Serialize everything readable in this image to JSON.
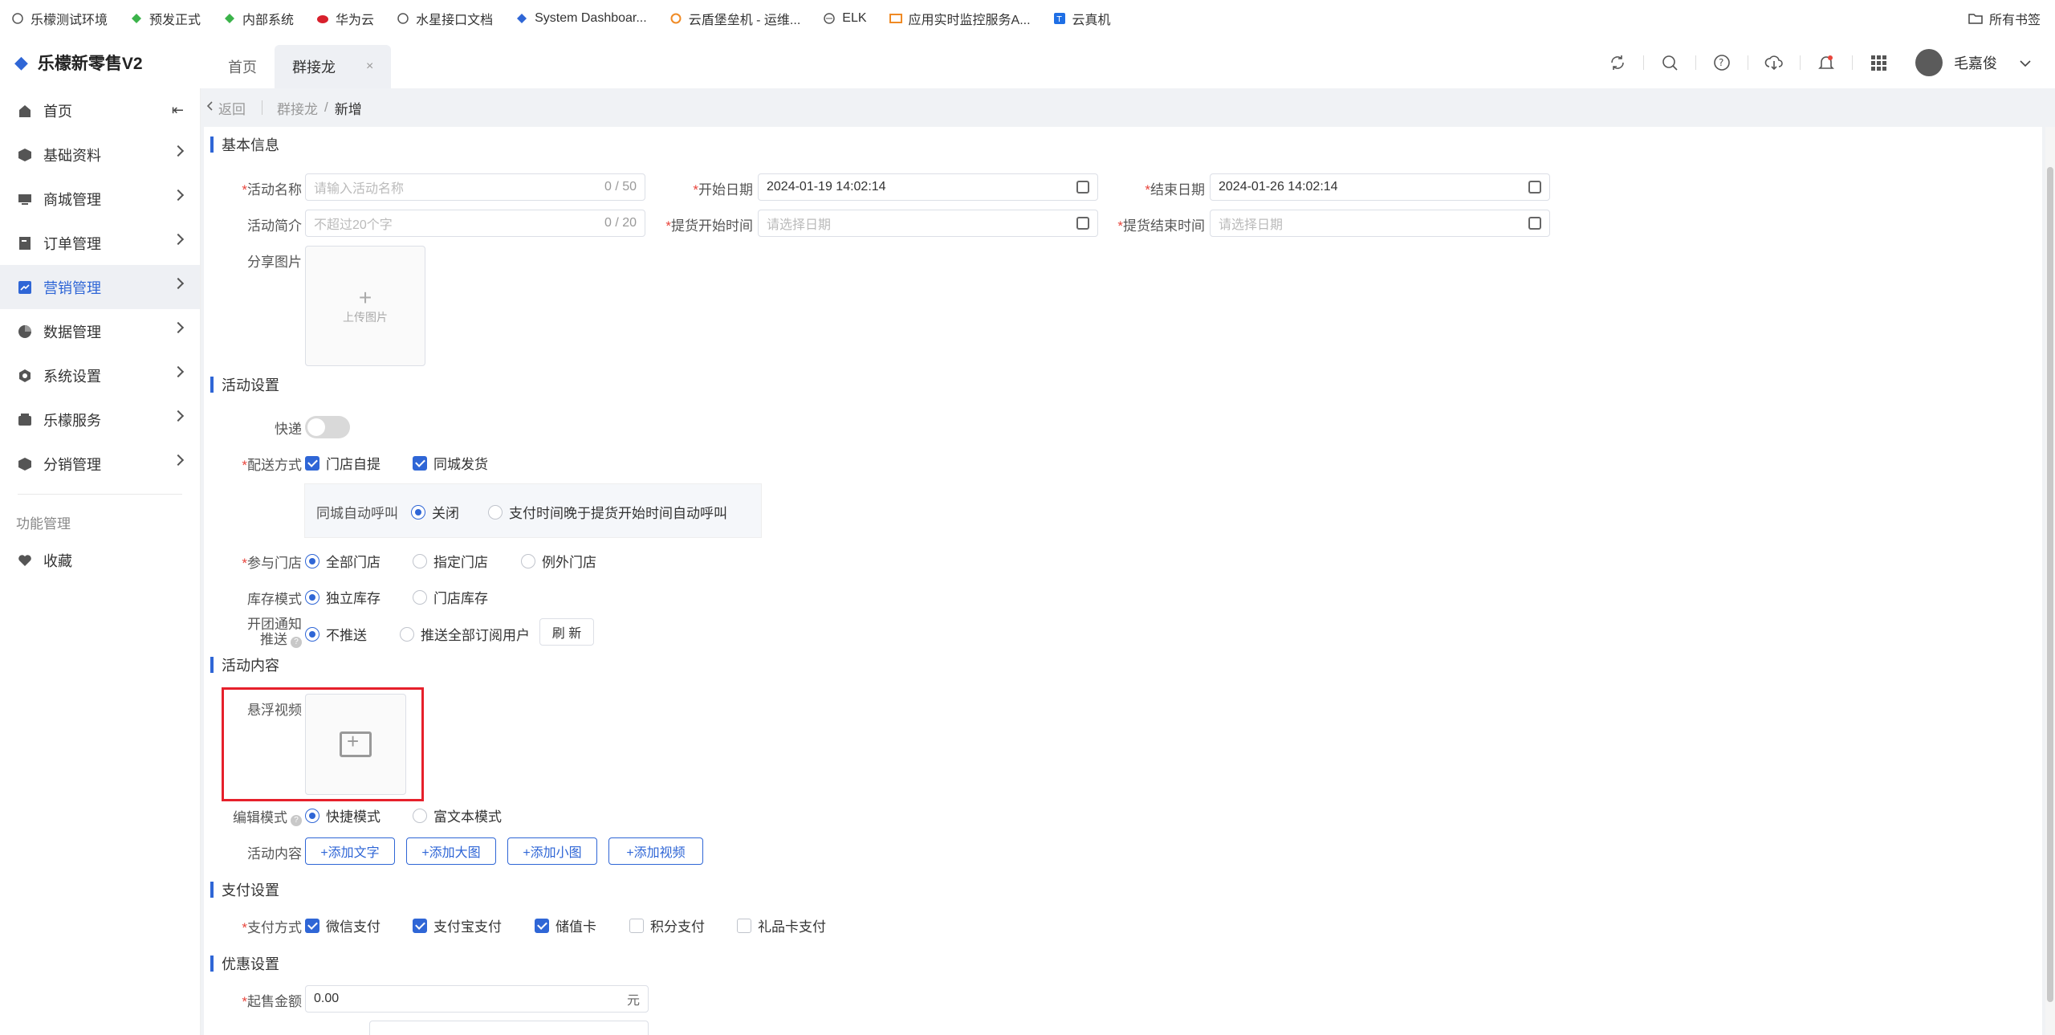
{
  "bookmarks": [
    {
      "label": "乐檬测试环境",
      "icon": "globe-icon"
    },
    {
      "label": "预发正式",
      "icon": "leaf-icon"
    },
    {
      "label": "内部系统",
      "icon": "leaf-icon"
    },
    {
      "label": "华为云",
      "icon": "huawei-icon"
    },
    {
      "label": "水星接口文档",
      "icon": "globe-icon"
    },
    {
      "label": "System Dashboar...",
      "icon": "jira-icon"
    },
    {
      "label": "云盾堡垒机 - 运维...",
      "icon": "cloud-icon"
    },
    {
      "label": "ELK",
      "icon": "elk-icon"
    },
    {
      "label": "应用实时监控服务A...",
      "icon": "arms-icon"
    },
    {
      "label": "云真机",
      "icon": "t-icon"
    }
  ],
  "bookmarks_all": "所有书签",
  "app": {
    "title": "乐檬新零售V2"
  },
  "tabs": [
    {
      "label": "首页",
      "active": false
    },
    {
      "label": "群接龙",
      "active": true,
      "close": "×"
    }
  ],
  "user": {
    "name": "毛嘉俊"
  },
  "sidebar": {
    "items": [
      {
        "label": "首页",
        "icon": "home-icon"
      },
      {
        "label": "基础资料",
        "icon": "cube-icon"
      },
      {
        "label": "商城管理",
        "icon": "monitor-icon"
      },
      {
        "label": "订单管理",
        "icon": "order-icon"
      },
      {
        "label": "营销管理",
        "icon": "chart-icon"
      },
      {
        "label": "数据管理",
        "icon": "pie-icon"
      },
      {
        "label": "系统设置",
        "icon": "settings-icon"
      },
      {
        "label": "乐檬服务",
        "icon": "service-icon"
      },
      {
        "label": "分销管理",
        "icon": "box-icon"
      }
    ],
    "group_label": "功能管理",
    "favorites": {
      "label": "收藏",
      "icon": "heart-icon"
    }
  },
  "breadcrumb": {
    "back": "返回",
    "parent": "群接龙",
    "sep": "/",
    "current": "新增"
  },
  "form": {
    "basic_section": "基本信息",
    "activity_name": {
      "label": "活动名称",
      "placeholder": "请输入活动名称",
      "count": "0 / 50"
    },
    "start_date": {
      "label": "开始日期",
      "value": "2024-01-19 14:02:14"
    },
    "end_date": {
      "label": "结束日期",
      "value": "2024-01-26 14:02:14"
    },
    "intro": {
      "label": "活动简介",
      "placeholder": "不超过20个字",
      "count": "0 / 20"
    },
    "pickup_start": {
      "label": "提货开始时间",
      "placeholder": "请选择日期"
    },
    "pickup_end": {
      "label": "提货结束时间",
      "placeholder": "请选择日期"
    },
    "share_image": {
      "label": "分享图片",
      "plus": "+",
      "upload": "上传图片"
    },
    "settings_section": "活动设置",
    "express": {
      "label": "快递",
      "on": false
    },
    "delivery": {
      "label": "配送方式",
      "options": [
        "门店自提",
        "同城发货"
      ]
    },
    "auto_call": {
      "label": "同城自动呼叫",
      "options": [
        "关闭",
        "支付时间晚于提货开始时间自动呼叫"
      ]
    },
    "stores": {
      "label": "参与门店",
      "options": [
        "全部门店",
        "指定门店",
        "例外门店"
      ]
    },
    "stock": {
      "label": "库存模式",
      "options": [
        "独立库存",
        "门店库存"
      ]
    },
    "notify": {
      "label1": "开团通知",
      "label2": "推送",
      "options": [
        "不推送",
        "推送全部订阅用户"
      ],
      "refresh": "刷 新"
    },
    "content_section": "活动内容",
    "video": {
      "label": "悬浮视频"
    },
    "edit_mode": {
      "label": "编辑模式",
      "options": [
        "快捷模式",
        "富文本模式"
      ]
    },
    "content": {
      "label": "活动内容",
      "buttons": [
        "+添加文字",
        "+添加大图",
        "+添加小图",
        "+添加视频"
      ]
    },
    "payment_section": "支付设置",
    "payment": {
      "label": "支付方式",
      "options": [
        "微信支付",
        "支付宝支付",
        "储值卡",
        "积分支付",
        "礼品卡支付"
      ]
    },
    "discount_section": "优惠设置",
    "min_amount": {
      "label": "起售金额",
      "value": "0.00",
      "unit": "元"
    },
    "required_mark": "*",
    "help_mark": "?"
  },
  "colors": {
    "accent": "#2f66d6",
    "required": "#e8453c",
    "highlight": "#e6202b"
  }
}
